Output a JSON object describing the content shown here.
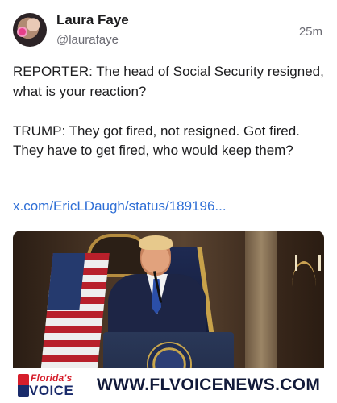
{
  "post": {
    "author": {
      "display_name": "Laura Faye",
      "handle": "@laurafaye",
      "avatar_icon": "profile-photo-avatar"
    },
    "timestamp": "25m",
    "paragraphs": [
      "REPORTER: The head of Social Security resigned, what is your reaction?",
      "TRUMP: They got fired, not resigned. Got fired. They have to get fired, who would keep them?"
    ],
    "link_text": "x.com/EricLDaugh/status/189196...",
    "media": {
      "banner": {
        "logo_top": "Florida's",
        "logo_bottom": "VOICE",
        "url_text": "WWW.FLVOICENEWS.COM"
      }
    }
  },
  "colors": {
    "link": "#2f6fd6",
    "secondary_text": "#6b6b73",
    "brand_red": "#d61e2b",
    "brand_navy": "#1a2b6b"
  }
}
